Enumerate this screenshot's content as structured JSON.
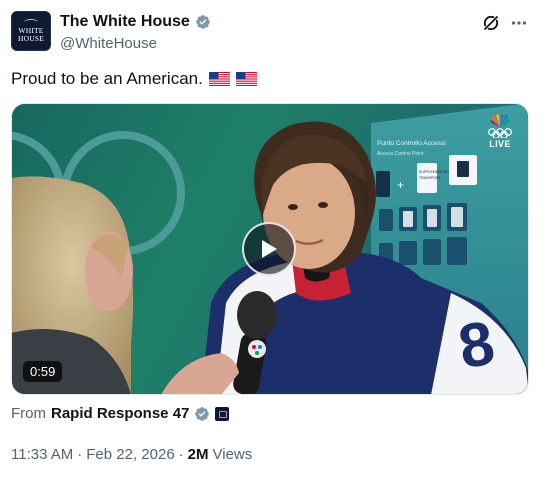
{
  "account": {
    "display_name": "The White House",
    "handle": "@WhiteHouse",
    "avatar_line1": "WHITE",
    "avatar_line2": "HOUSE"
  },
  "tweet": {
    "text": "Proud to be an American.",
    "emoji": [
      "us-flag",
      "us-flag"
    ]
  },
  "video": {
    "duration": "0:59",
    "overlay_text": "LIVE",
    "sign_title": "Punto Controllo Accessi",
    "sign_subtitle": "Access Control Point",
    "sign_card_1": "SUPPLEMENTARY",
    "sign_card_2": "TRANSPORT",
    "jersey_number": "8"
  },
  "attribution": {
    "from_label": "From",
    "source_name": "Rapid Response 47"
  },
  "meta": {
    "time": "11:33 AM",
    "separator": "·",
    "date": "Feb 22, 2026",
    "views_count": "2M",
    "views_label": "Views"
  },
  "colors": {
    "verified": "#829aab",
    "text_primary": "#0f1419",
    "text_secondary": "#536471",
    "video_bg": "#1d6a66"
  }
}
